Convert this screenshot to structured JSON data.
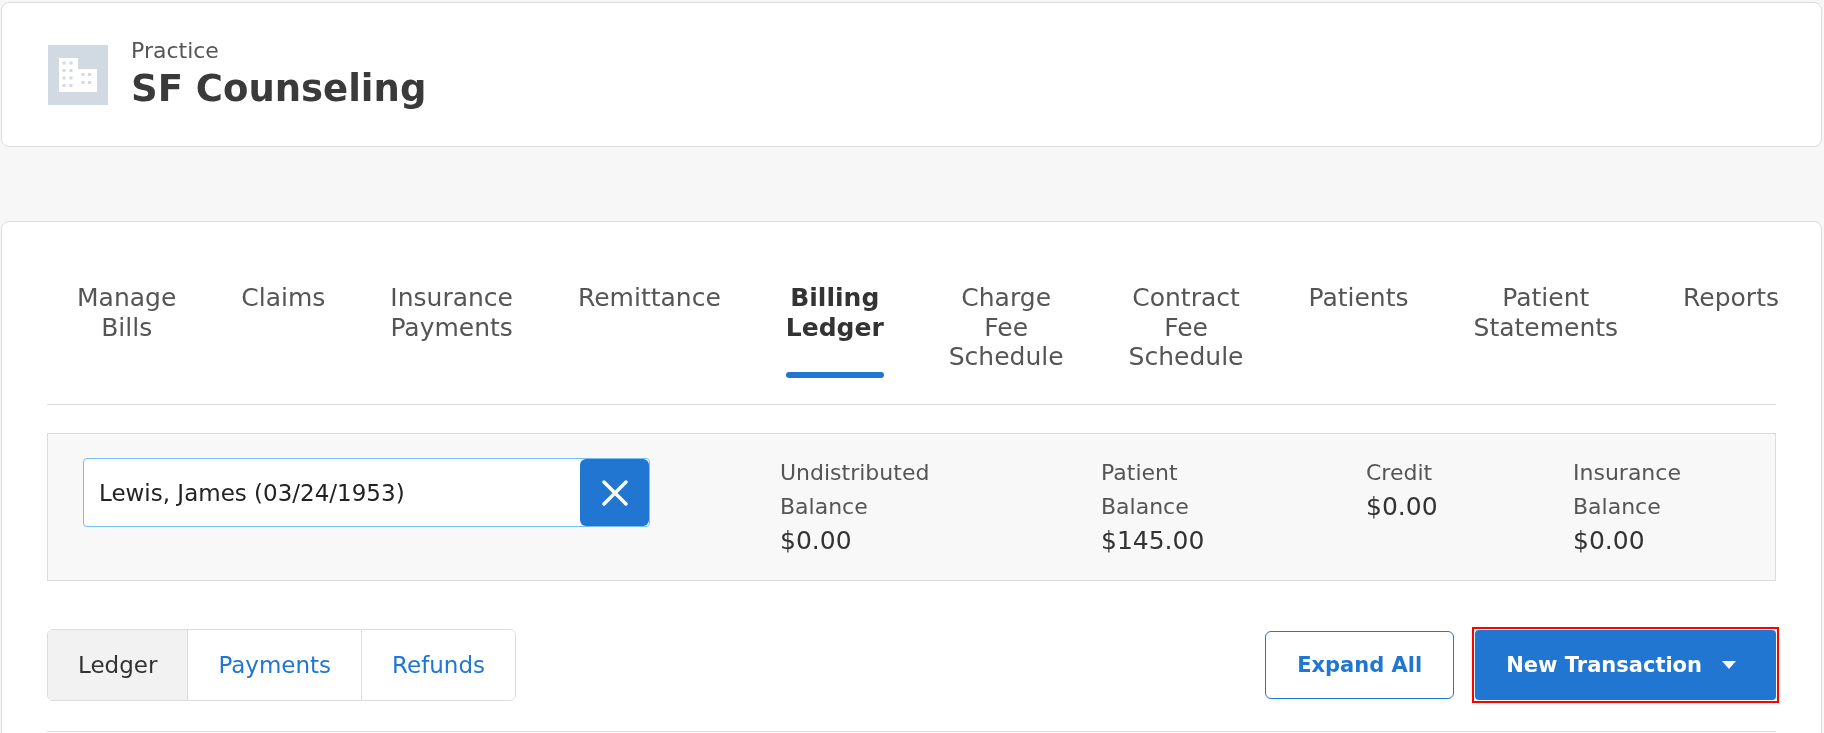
{
  "header": {
    "caption": "Practice",
    "title": "SF Counseling"
  },
  "tabs": [
    {
      "label": "Manage Bills",
      "selected": false
    },
    {
      "label": "Claims",
      "selected": false
    },
    {
      "label": "Insurance Payments",
      "selected": false
    },
    {
      "label": "Remittance",
      "selected": false
    },
    {
      "label": "Billing Ledger",
      "selected": true
    },
    {
      "label": "Charge Fee Schedule",
      "selected": false
    },
    {
      "label": "Contract Fee Schedule",
      "selected": false
    },
    {
      "label": "Patients",
      "selected": false
    },
    {
      "label": "Patient Statements",
      "selected": false
    },
    {
      "label": "Reports",
      "selected": false
    }
  ],
  "patient_search": {
    "value": "Lewis, James (03/24/1953)"
  },
  "balances": [
    {
      "label": "Undistributed Balance",
      "value": "$0.00"
    },
    {
      "label": "Patient Balance",
      "value": "$145.00"
    },
    {
      "label": "Credit",
      "value": "$0.00"
    },
    {
      "label": "Insurance Balance",
      "value": "$0.00"
    }
  ],
  "view_tabs": [
    {
      "label": "Ledger",
      "selected": true
    },
    {
      "label": "Payments",
      "selected": false
    },
    {
      "label": "Refunds",
      "selected": false
    }
  ],
  "actions": [
    {
      "label": "Expand All",
      "kind": "outline",
      "highlighted": false
    },
    {
      "label": "New Transaction",
      "kind": "dropdown",
      "highlighted": true
    }
  ]
}
